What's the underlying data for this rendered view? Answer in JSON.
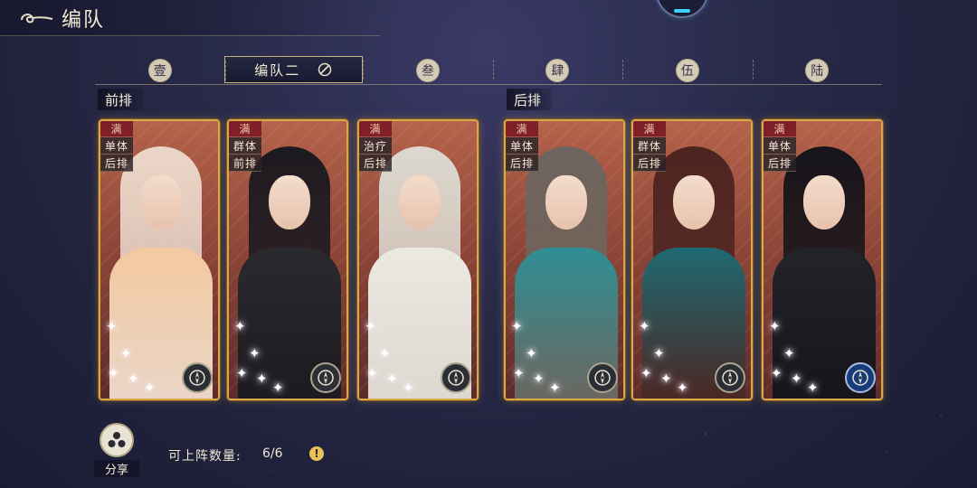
{
  "header": {
    "title": "编队"
  },
  "tabs": [
    {
      "label": "壹",
      "active": false
    },
    {
      "label": "编队二",
      "active": true
    },
    {
      "label": "叁",
      "active": false
    },
    {
      "label": "肆",
      "active": false
    },
    {
      "label": "伍",
      "active": false
    },
    {
      "label": "陆",
      "active": false
    }
  ],
  "rows": {
    "front": "前排",
    "back": "后排"
  },
  "cards": [
    {
      "full": "满",
      "tags": [
        "单体",
        "后排"
      ],
      "stars": 5,
      "palette": [
        "#ead6c8",
        "#f3c9a0"
      ],
      "role_icon": "compass-icon"
    },
    {
      "full": "满",
      "tags": [
        "群体",
        "前排"
      ],
      "stars": 5,
      "palette": [
        "#1c1a1f",
        "#2a2a2e"
      ],
      "role_icon": "compass-icon"
    },
    {
      "full": "满",
      "tags": [
        "治疗",
        "后排"
      ],
      "stars": 5,
      "palette": [
        "#dcd8cf",
        "#ebe9e2"
      ],
      "role_icon": "compass-icon"
    },
    {
      "full": "满",
      "tags": [
        "单体",
        "后排"
      ],
      "stars": 5,
      "palette": [
        "#6d655e",
        "#2f8f94"
      ],
      "role_icon": "compass-icon"
    },
    {
      "full": "满",
      "tags": [
        "群体",
        "后排"
      ],
      "stars": 5,
      "palette": [
        "#4d2420",
        "#1e6a72"
      ],
      "role_icon": "compass-icon"
    },
    {
      "full": "满",
      "tags": [
        "单体",
        "后排"
      ],
      "stars": 5,
      "palette": [
        "#16141a",
        "#23232a"
      ],
      "role_icon": "compass-blue-icon"
    }
  ],
  "footer": {
    "share_label": "分享",
    "count_label": "可上阵数量:",
    "count_value": "6/6",
    "info_symbol": "!"
  }
}
